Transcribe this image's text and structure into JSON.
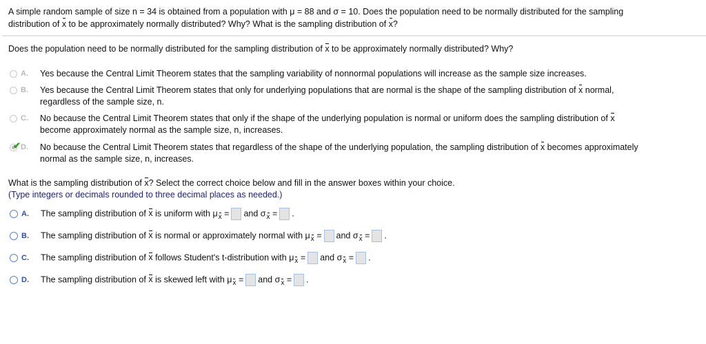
{
  "prompt": {
    "line1": "A simple random sample of size n = 34 is obtained from a population with μ = 88 and σ = 10. Does the population need to be normally distributed for the sampling",
    "line2_pre": "distribution of ",
    "line2_mid": " to be approximately normally distributed? Why? What is the sampling distribution of ",
    "line2_post": "?",
    "xbar_symbol": "x"
  },
  "question1": {
    "pre": "Does the population need to be normally distributed for the sampling distribution of ",
    "post": " to be approximately normally distributed? Why?",
    "selected": "D",
    "options": [
      {
        "letter": "A.",
        "text": "Yes because the Central Limit Theorem states that the sampling variability of nonnormal populations will increase as the sample size increases."
      },
      {
        "letter": "B.",
        "text_pre": "Yes because the Central Limit Theorem states that only for underlying populations that are normal is the shape of the sampling distribution of ",
        "text_post": " normal,",
        "line2": "regardless of the sample size, n."
      },
      {
        "letter": "C.",
        "text_pre": "No because the Central Limit Theorem states that only if the shape of the underlying population is normal or uniform does the sampling distribution of ",
        "text_post": "",
        "line2": "become approximately normal as the sample size, n, increases."
      },
      {
        "letter": "D.",
        "text_pre": "No because the Central Limit Theorem states that regardless of the shape of the underlying population, the sampling distribution of ",
        "text_post": " becomes approximately",
        "line2": "normal as the sample size, n, increases."
      }
    ]
  },
  "question2": {
    "pre": "What is the sampling distribution of ",
    "post": "? Select the correct choice below and fill in the answer boxes within your choice.",
    "hint": "(Type integers or decimals rounded to three decimal places as needed.)",
    "mu": "μ",
    "sigma": "σ",
    "eq": "=",
    "and": "and",
    "period": ".",
    "options": [
      {
        "letter": "A.",
        "pre": "The sampling distribution of ",
        "post": " is uniform with ",
        "mu_value": "",
        "sigma_value": ""
      },
      {
        "letter": "B.",
        "pre": "The sampling distribution of ",
        "post": " is normal or approximately normal with ",
        "mu_value": "",
        "sigma_value": ""
      },
      {
        "letter": "C.",
        "pre": "The sampling distribution of ",
        "post": " follows Student's t-distribution with ",
        "mu_value": "",
        "sigma_value": ""
      },
      {
        "letter": "D.",
        "pre": "The sampling distribution of ",
        "post": " is skewed left with ",
        "mu_value": "",
        "sigma_value": ""
      }
    ]
  },
  "colors": {
    "hint": "#1c1e7d",
    "radio_active": "#5b80d8",
    "letter_active": "#2f4fb7",
    "letter_inactive": "#b8b8b8",
    "check": "#2e9a1e",
    "divider": "#e1e5ea",
    "answer_box": "#e4e4e4"
  }
}
